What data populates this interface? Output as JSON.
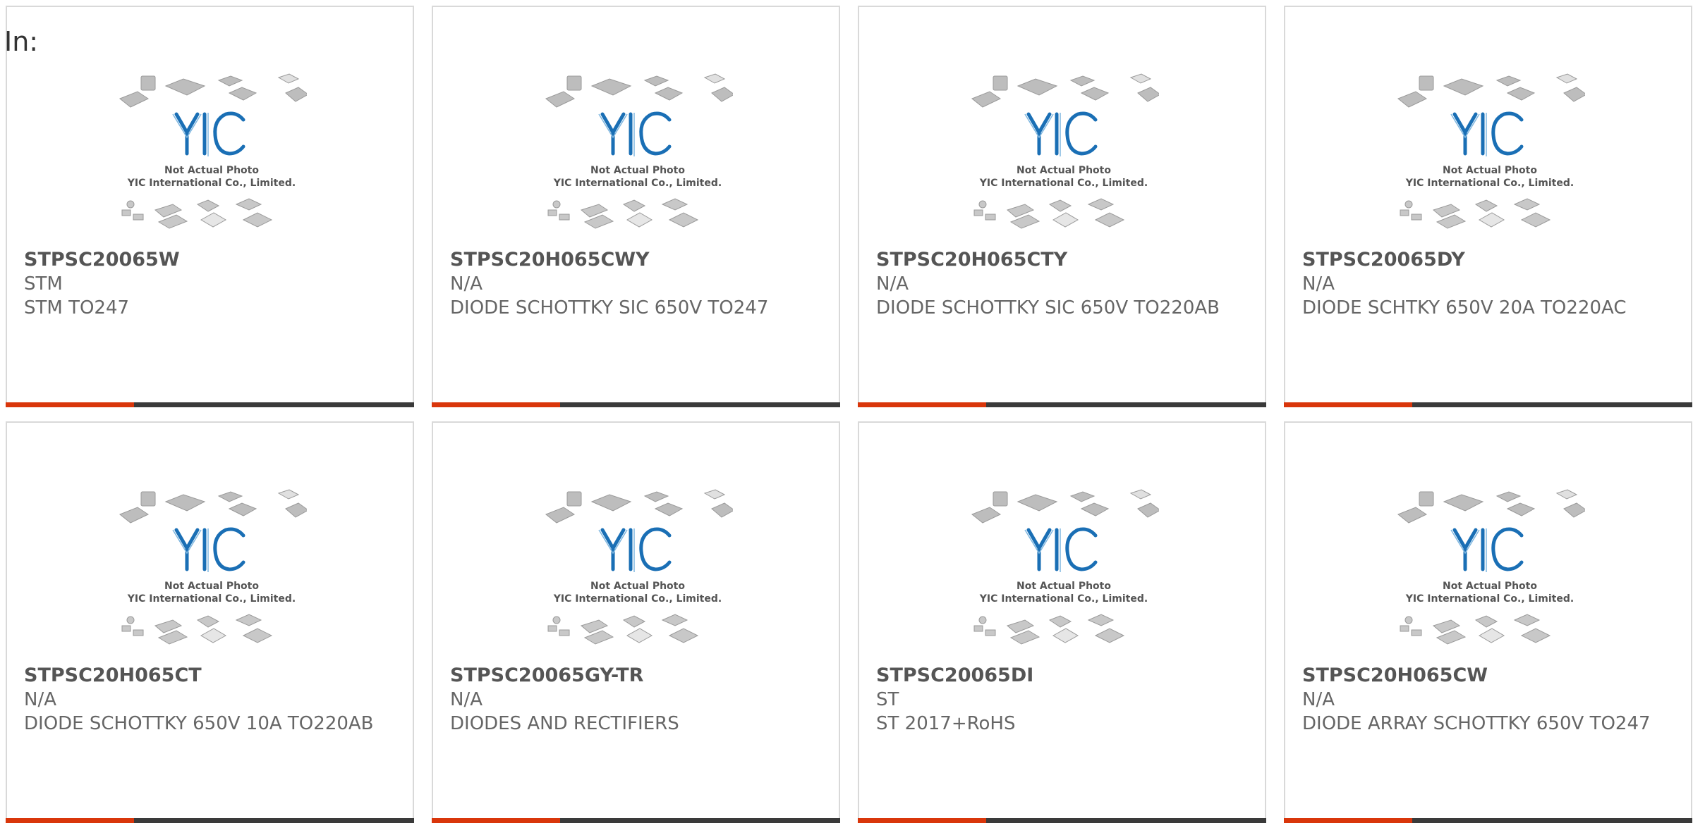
{
  "header": {
    "in_label": "In:"
  },
  "thumbnail": {
    "logo": "YIC",
    "line1": "Not Actual Photo",
    "line2": "YIC International Co., Limited."
  },
  "colors": {
    "accent": "#d9360b",
    "bar": "#3a3a3a",
    "logo": "#1a6fb5",
    "text": "#666666"
  },
  "products": [
    {
      "part": "STPSC20065W",
      "manufacturer": "STM",
      "description": "STM TO247"
    },
    {
      "part": "STPSC20H065CWY",
      "manufacturer": "N/A",
      "description": "DIODE SCHOTTKY SIC 650V TO247"
    },
    {
      "part": "STPSC20H065CTY",
      "manufacturer": "N/A",
      "description": "DIODE SCHOTTKY SIC 650V TO220AB"
    },
    {
      "part": "STPSC20065DY",
      "manufacturer": "N/A",
      "description": "DIODE SCHTKY 650V 20A TO220AC"
    },
    {
      "part": "STPSC20H065CT",
      "manufacturer": "N/A",
      "description": "DIODE SCHOTTKY 650V 10A TO220AB"
    },
    {
      "part": "STPSC20065GY-TR",
      "manufacturer": "N/A",
      "description": "DIODES AND RECTIFIERS"
    },
    {
      "part": "STPSC20065DI",
      "manufacturer": "ST",
      "description": "ST 2017+RoHS"
    },
    {
      "part": "STPSC20H065CW",
      "manufacturer": "N/A",
      "description": "DIODE ARRAY SCHOTTKY 650V TO247"
    }
  ]
}
